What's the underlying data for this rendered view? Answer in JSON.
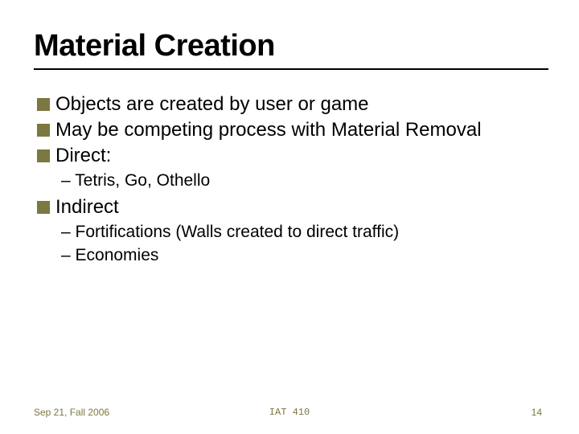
{
  "title": "Material Creation",
  "bullets": {
    "b0": "Objects are created by user or game",
    "b1": "May be competing process with Material Removal",
    "b2": "Direct:",
    "b2_sub0": "– Tetris, Go, Othello",
    "b3": "Indirect",
    "b3_sub0": "– Fortifications  (Walls created to direct traffic)",
    "b3_sub1": "– Economies"
  },
  "footer": {
    "date": "Sep 21, Fall 2006",
    "course": "IAT 410",
    "page": "14"
  }
}
